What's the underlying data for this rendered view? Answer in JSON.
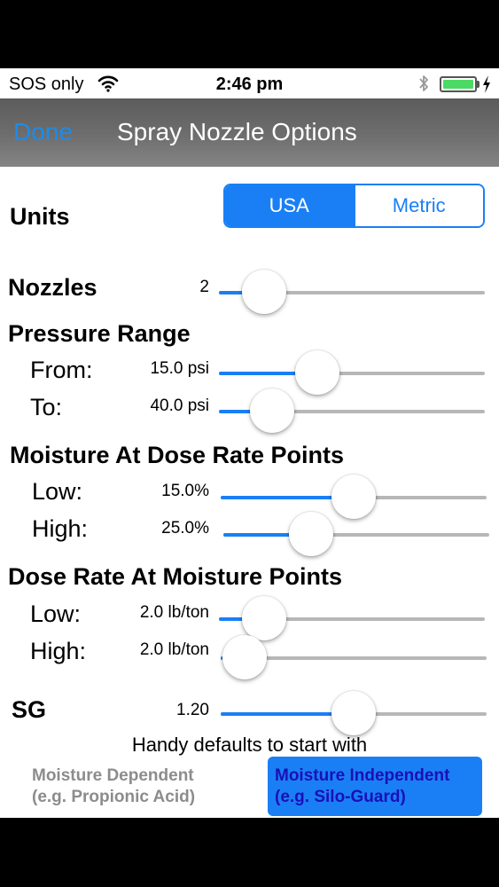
{
  "status_bar": {
    "carrier": "SOS only",
    "time": "2:46 pm",
    "battery_percent": 100
  },
  "nav": {
    "done_label": "Done",
    "title": "Spray Nozzle Options"
  },
  "units": {
    "label": "Units",
    "options": [
      "USA",
      "Metric"
    ],
    "selected": "USA"
  },
  "nozzles": {
    "label": "Nozzles",
    "value": "2",
    "slider_fraction": 0.17
  },
  "pressure": {
    "title": "Pressure Range",
    "from": {
      "label": "From:",
      "value": "15.0 psi",
      "slider_fraction": 0.37
    },
    "to": {
      "label": "To:",
      "value": "40.0 psi",
      "slider_fraction": 0.2
    }
  },
  "moisture": {
    "title": "Moisture At Dose Rate Points",
    "low": {
      "label": "Low:",
      "value": "15.0%",
      "slider_fraction": 0.5
    },
    "high": {
      "label": "High:",
      "value": "25.0%",
      "slider_fraction": 0.33
    }
  },
  "dose": {
    "title": "Dose Rate At Moisture Points",
    "low": {
      "label": "Low:",
      "value": "2.0 lb/ton",
      "slider_fraction": 0.17
    },
    "high": {
      "label": "High:",
      "value": "2.0 lb/ton",
      "slider_fraction": 0.09
    }
  },
  "sg": {
    "label": "SG",
    "value": "1.20",
    "slider_fraction": 0.5
  },
  "defaults": {
    "caption": "Handy defaults to start with",
    "left": {
      "line1": "Moisture Dependent",
      "line2": "(e.g. Propionic Acid)"
    },
    "right": {
      "line1": "Moisture Independent",
      "line2": "(e.g. Silo-Guard)"
    }
  },
  "colors": {
    "accent": "#1a7ff5",
    "track": "#b7b7b7",
    "battery": "#4cd964"
  },
  "icons": [
    "wifi-icon",
    "bluetooth-icon",
    "battery-icon",
    "charging-icon"
  ]
}
